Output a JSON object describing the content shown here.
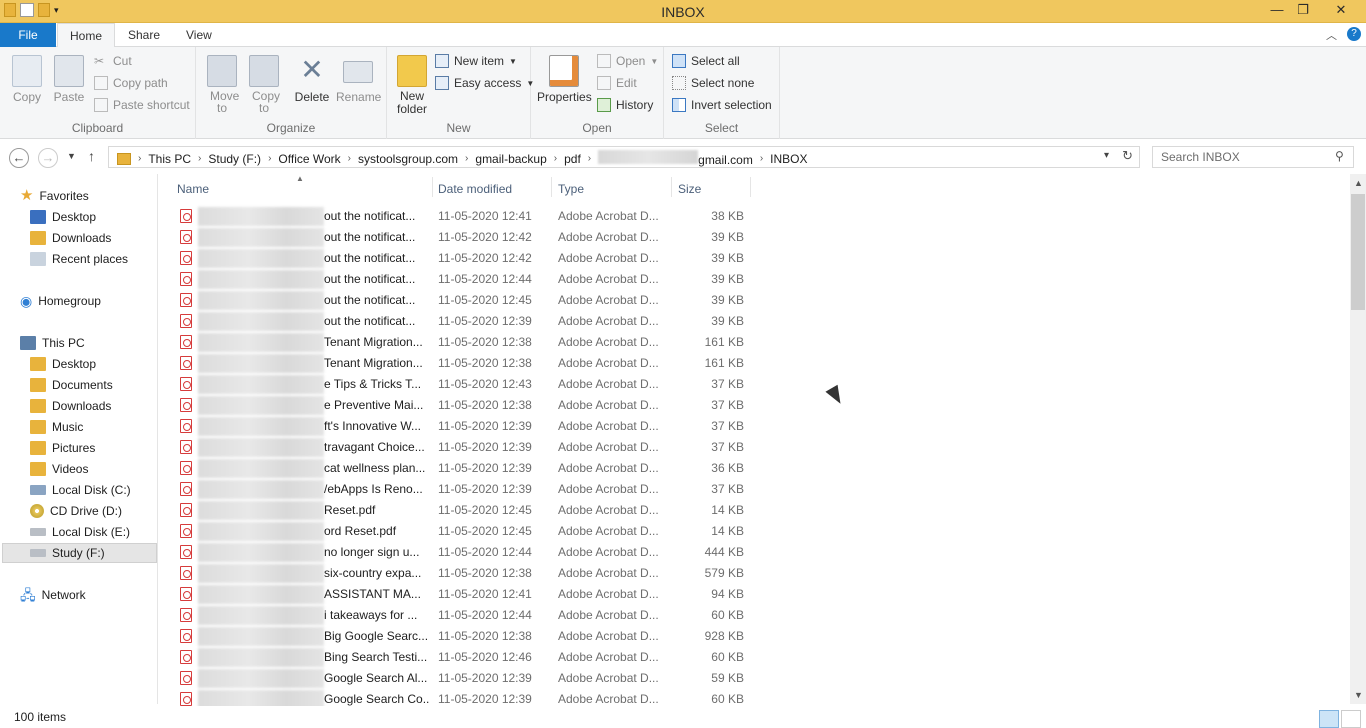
{
  "window": {
    "title": "INBOX",
    "minimize": "—",
    "maximize": "❐",
    "close": "✕"
  },
  "tabs": {
    "file": "File",
    "home": "Home",
    "share": "Share",
    "view": "View"
  },
  "ribbon": {
    "clipboard": {
      "name": "Clipboard",
      "copy": "Copy",
      "paste": "Paste",
      "cut": "Cut",
      "copy_path": "Copy path",
      "paste_shortcut": "Paste shortcut"
    },
    "organize": {
      "name": "Organize",
      "move_to": "Move to",
      "copy_to": "Copy to",
      "delete": "Delete",
      "rename": "Rename"
    },
    "new": {
      "name": "New",
      "new_folder": "New folder",
      "new_item": "New item",
      "easy_access": "Easy access"
    },
    "open": {
      "name": "Open",
      "properties": "Properties",
      "open": "Open",
      "edit": "Edit",
      "history": "History"
    },
    "select": {
      "name": "Select",
      "select_all": "Select all",
      "select_none": "Select none",
      "invert": "Invert selection"
    }
  },
  "address": {
    "crumbs": [
      "This PC",
      "Study (F:)",
      "Office Work",
      "systoolsgroup.com",
      "gmail-backup",
      "pdf"
    ],
    "account_suffix": "gmail.com",
    "last": "INBOX",
    "search_placeholder": "Search INBOX"
  },
  "nav": {
    "favorites": "Favorites",
    "desktop": "Desktop",
    "downloads": "Downloads",
    "recent": "Recent places",
    "homegroup": "Homegroup",
    "thispc": "This PC",
    "pc_desktop": "Desktop",
    "documents": "Documents",
    "pc_downloads": "Downloads",
    "music": "Music",
    "pictures": "Pictures",
    "videos": "Videos",
    "c": "Local Disk (C:)",
    "d": "CD Drive (D:)",
    "e": "Local Disk (E:)",
    "f": "Study (F:)",
    "network": "Network"
  },
  "columns": {
    "name": "Name",
    "date": "Date modified",
    "type": "Type",
    "size": "Size"
  },
  "files": [
    {
      "name": "out the notificat...",
      "date": "11-05-2020 12:41",
      "type": "Adobe Acrobat D...",
      "size": "38 KB"
    },
    {
      "name": "out the notificat...",
      "date": "11-05-2020 12:42",
      "type": "Adobe Acrobat D...",
      "size": "39 KB"
    },
    {
      "name": "out the notificat...",
      "date": "11-05-2020 12:42",
      "type": "Adobe Acrobat D...",
      "size": "39 KB"
    },
    {
      "name": "out the notificat...",
      "date": "11-05-2020 12:44",
      "type": "Adobe Acrobat D...",
      "size": "39 KB"
    },
    {
      "name": "out the notificat...",
      "date": "11-05-2020 12:45",
      "type": "Adobe Acrobat D...",
      "size": "39 KB"
    },
    {
      "name": "out the notificat...",
      "date": "11-05-2020 12:39",
      "type": "Adobe Acrobat D...",
      "size": "39 KB"
    },
    {
      "name": "Tenant Migration...",
      "date": "11-05-2020 12:38",
      "type": "Adobe Acrobat D...",
      "size": "161 KB"
    },
    {
      "name": "Tenant Migration...",
      "date": "11-05-2020 12:38",
      "type": "Adobe Acrobat D...",
      "size": "161 KB"
    },
    {
      "name": "e Tips & Tricks T...",
      "date": "11-05-2020 12:43",
      "type": "Adobe Acrobat D...",
      "size": "37 KB"
    },
    {
      "name": "e Preventive Mai...",
      "date": "11-05-2020 12:38",
      "type": "Adobe Acrobat D...",
      "size": "37 KB"
    },
    {
      "name": "ft's Innovative W...",
      "date": "11-05-2020 12:39",
      "type": "Adobe Acrobat D...",
      "size": "37 KB"
    },
    {
      "name": "travagant Choice...",
      "date": "11-05-2020 12:39",
      "type": "Adobe Acrobat D...",
      "size": "37 KB"
    },
    {
      "name": "cat wellness plan...",
      "date": "11-05-2020 12:39",
      "type": "Adobe Acrobat D...",
      "size": "36 KB"
    },
    {
      "name": "/ebApps Is Reno...",
      "date": "11-05-2020 12:39",
      "type": "Adobe Acrobat D...",
      "size": "37 KB"
    },
    {
      "name": "Reset.pdf",
      "date": "11-05-2020 12:45",
      "type": "Adobe Acrobat D...",
      "size": "14 KB"
    },
    {
      "name": "ord Reset.pdf",
      "date": "11-05-2020 12:45",
      "type": "Adobe Acrobat D...",
      "size": "14 KB"
    },
    {
      "name": "no longer sign u...",
      "date": "11-05-2020 12:44",
      "type": "Adobe Acrobat D...",
      "size": "444 KB"
    },
    {
      "name": "six-country expa...",
      "date": "11-05-2020 12:38",
      "type": "Adobe Acrobat D...",
      "size": "579 KB"
    },
    {
      "name": "ASSISTANT MA...",
      "date": "11-05-2020 12:41",
      "type": "Adobe Acrobat D...",
      "size": "94 KB"
    },
    {
      "name": "i takeaways for ...",
      "date": "11-05-2020 12:44",
      "type": "Adobe Acrobat D...",
      "size": "60 KB"
    },
    {
      "name": "Big Google Searc...",
      "date": "11-05-2020 12:38",
      "type": "Adobe Acrobat D...",
      "size": "928 KB"
    },
    {
      "name": "Bing Search Testi...",
      "date": "11-05-2020 12:46",
      "type": "Adobe Acrobat D...",
      "size": "60 KB"
    },
    {
      "name": "Google Search Al...",
      "date": "11-05-2020 12:39",
      "type": "Adobe Acrobat D...",
      "size": "59 KB"
    },
    {
      "name": "Google Search Co...",
      "date": "11-05-2020 12:39",
      "type": "Adobe Acrobat D...",
      "size": "60 KB"
    }
  ],
  "status": {
    "count": "100 items"
  }
}
